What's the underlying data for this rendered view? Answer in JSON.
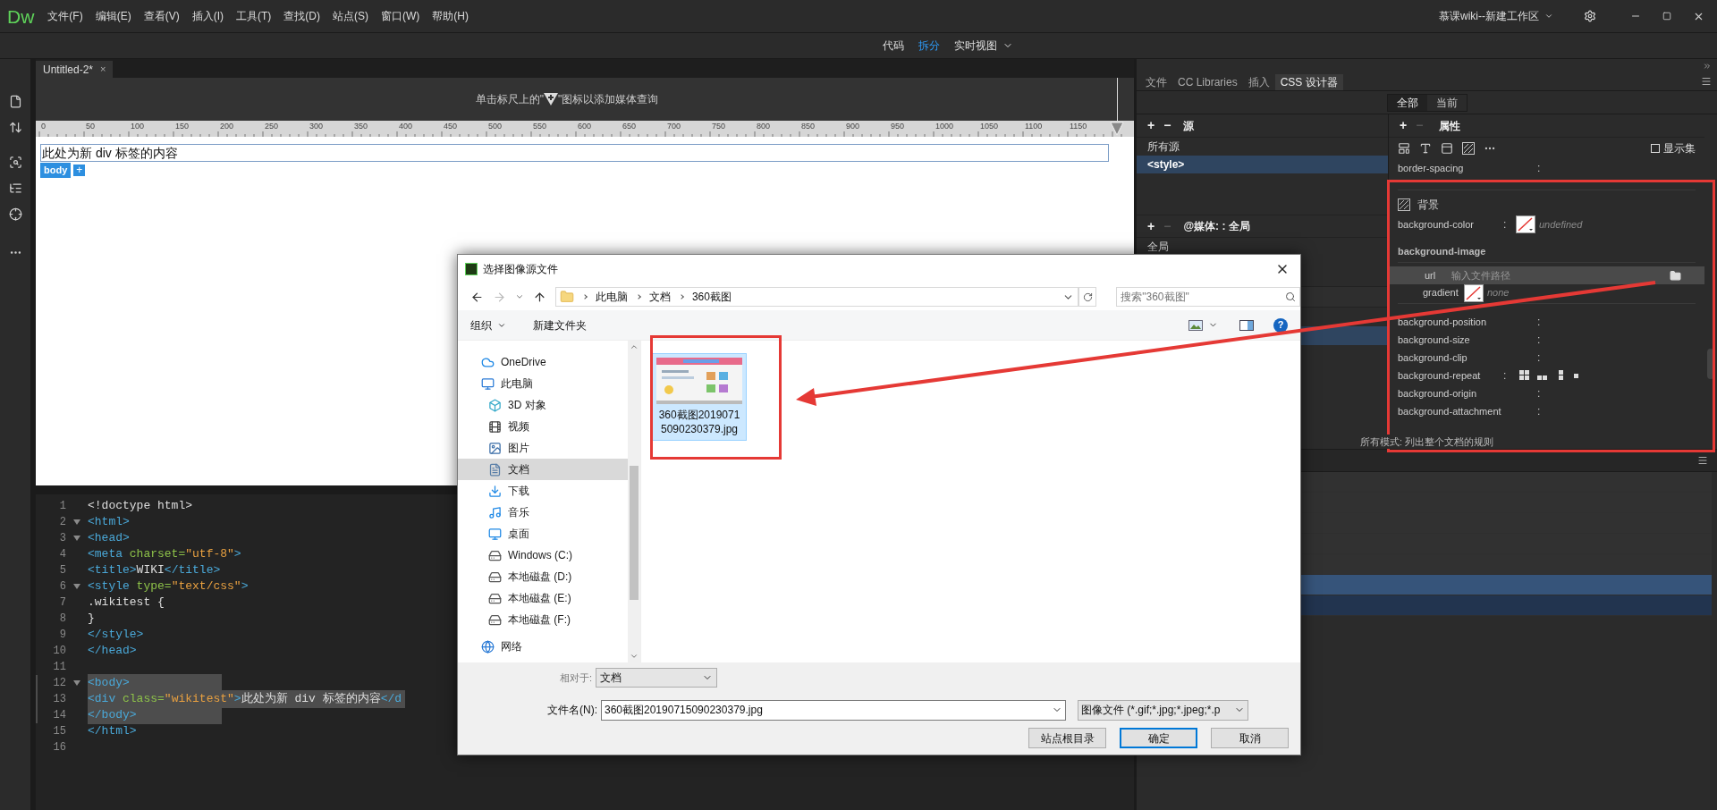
{
  "app": {
    "logo": "Dw",
    "menu": [
      "文件(F)",
      "编辑(E)",
      "查看(V)",
      "插入(I)",
      "工具(T)",
      "查找(D)",
      "站点(S)",
      "窗口(W)",
      "帮助(H)"
    ],
    "workspace": "慕课wiki--新建工作区"
  },
  "view_switch": [
    {
      "label": "代码",
      "selected": false
    },
    {
      "label": "拆分",
      "selected": true
    },
    {
      "label": "实时视图",
      "selected": false
    }
  ],
  "tool_strip": [
    {
      "kind": "file"
    },
    {
      "kind": "transfer"
    },
    {
      "kind": "inspect"
    },
    {
      "kind": "structure"
    },
    {
      "kind": "target"
    },
    {
      "kind": "more"
    }
  ],
  "document_tab": {
    "title": "Untitled-2*",
    "close": "×"
  },
  "design_view": {
    "hint_before": "单击标尺上的\"",
    "hint_after": "\"图标以添加媒体查询",
    "ruler": [
      "0",
      "50",
      "100",
      "150",
      "200",
      "250",
      "300",
      "350",
      "400",
      "450",
      "500",
      "550",
      "600",
      "650",
      "700",
      "750",
      "800",
      "850",
      "900",
      "950",
      "1000",
      "1050",
      "1100",
      "1150"
    ],
    "div_text": "此处为新 div 标签的内容",
    "tag": "body",
    "tag_add": "+"
  },
  "code": {
    "lines": [
      {
        "number": "1",
        "foldable": false,
        "selected": false,
        "tokens": [
          {
            "text": "<!doctype html>",
            "kind": "plain"
          }
        ]
      },
      {
        "number": "2",
        "foldable": true,
        "selected": false,
        "tokens": [
          {
            "text": "<html>",
            "kind": "tag"
          }
        ]
      },
      {
        "number": "3",
        "foldable": true,
        "selected": false,
        "tokens": [
          {
            "text": "<head>",
            "kind": "tag"
          }
        ]
      },
      {
        "number": "4",
        "foldable": false,
        "selected": false,
        "tokens": [
          {
            "text": "<meta ",
            "kind": "tag"
          },
          {
            "text": "charset=",
            "kind": "attr"
          },
          {
            "text": "\"utf-8\"",
            "kind": "string"
          },
          {
            "text": ">",
            "kind": "tag"
          }
        ]
      },
      {
        "number": "5",
        "foldable": false,
        "selected": false,
        "tokens": [
          {
            "text": "<title>",
            "kind": "tag"
          },
          {
            "text": "WIKI",
            "kind": "plain"
          },
          {
            "text": "</title>",
            "kind": "tag"
          }
        ]
      },
      {
        "number": "6",
        "foldable": true,
        "selected": false,
        "tokens": [
          {
            "text": "<style ",
            "kind": "tag"
          },
          {
            "text": "type=",
            "kind": "attr"
          },
          {
            "text": "\"text/css\"",
            "kind": "string"
          },
          {
            "text": ">",
            "kind": "tag"
          }
        ]
      },
      {
        "number": "7",
        "foldable": false,
        "selected": false,
        "tokens": [
          {
            "text": ".wikitest {",
            "kind": "plain"
          }
        ]
      },
      {
        "number": "8",
        "foldable": false,
        "selected": false,
        "tokens": [
          {
            "text": "}",
            "kind": "plain"
          }
        ]
      },
      {
        "number": "9",
        "foldable": false,
        "selected": false,
        "tokens": [
          {
            "text": "</style>",
            "kind": "tag"
          }
        ]
      },
      {
        "number": "10",
        "foldable": false,
        "selected": false,
        "tokens": [
          {
            "text": "</head>",
            "kind": "tag"
          }
        ]
      },
      {
        "number": "11",
        "foldable": false,
        "selected": false
      },
      {
        "number": "12",
        "foldable": true,
        "selected": true,
        "tokens": [
          {
            "text": "<body>",
            "kind": "tag"
          }
        ]
      },
      {
        "number": "13",
        "foldable": false,
        "selected": true,
        "tokens": [
          {
            "text": "<div ",
            "kind": "tag"
          },
          {
            "text": "class=",
            "kind": "attr"
          },
          {
            "text": "\"wikitest\"",
            "kind": "string"
          },
          {
            "text": ">",
            "kind": "tag"
          },
          {
            "text": "此处为新 div 标签的内容",
            "kind": "plain"
          },
          {
            "text": "</d",
            "kind": "tag"
          }
        ]
      },
      {
        "number": "14",
        "foldable": false,
        "selected": true,
        "tokens": [
          {
            "text": "</body>",
            "kind": "tag"
          }
        ]
      },
      {
        "number": "15",
        "foldable": false,
        "selected": false,
        "tokens": [
          {
            "text": "</html>",
            "kind": "tag"
          }
        ]
      },
      {
        "number": "16",
        "foldable": false,
        "selected": false
      }
    ]
  },
  "panel": {
    "tabs": [
      {
        "label": "文件",
        "selected": false
      },
      {
        "label": "CC Libraries",
        "selected": false
      },
      {
        "label": "插入",
        "selected": false
      },
      {
        "label": "CSS 设计器",
        "selected": true
      }
    ],
    "filter": [
      {
        "label": "全部",
        "selected": true
      },
      {
        "label": "当前",
        "selected": false
      }
    ],
    "sources": {
      "add": "+",
      "remove": "−",
      "title": "源",
      "items": [
        {
          "label": "所有源",
          "selected": false
        },
        {
          "label": "<style>",
          "selected": true
        }
      ]
    },
    "media": {
      "add": "+",
      "remove": "−",
      "title": "@媒体: : 全局",
      "items": [
        {
          "label": "全局"
        }
      ]
    },
    "selectors": {
      "rows": [
        {
          "selected": false
        },
        {
          "selected": true
        }
      ]
    },
    "properties": {
      "add": "+",
      "remove": "−",
      "title": "属性",
      "show_set": {
        "label": "显示集",
        "checked": false
      },
      "rows": [
        {
          "kind": "plain",
          "name": "border-spacing",
          "sep": ":"
        },
        {
          "kind": "section",
          "name": "背景"
        },
        {
          "kind": "swatch",
          "name": "background-color",
          "sep": ":",
          "value": "undefined"
        },
        {
          "kind": "heading",
          "name": "background-image"
        },
        {
          "kind": "url",
          "name": "url",
          "placeholder": "输入文件路径"
        },
        {
          "kind": "gradient",
          "name": "gradient",
          "value": "none"
        },
        {
          "kind": "plain",
          "name": "background-position",
          "sep": ":"
        },
        {
          "kind": "plain",
          "name": "background-size",
          "sep": ":"
        },
        {
          "kind": "plain",
          "name": "background-clip",
          "sep": ":"
        },
        {
          "kind": "repeat",
          "name": "background-repeat",
          "sep": ":"
        },
        {
          "kind": "plain",
          "name": "background-origin",
          "sep": ":"
        },
        {
          "kind": "plain",
          "name": "background-attachment",
          "sep": ":"
        }
      ]
    },
    "footer": "所有模式: 列出整个文档的规则",
    "lower_rows": [
      {
        "selected": false,
        "hovered": false
      },
      {
        "selected": false,
        "hovered": false
      },
      {
        "selected": false,
        "hovered": false
      },
      {
        "selected": false,
        "hovered": false
      },
      {
        "selected": false,
        "hovered": false
      },
      {
        "selected": true,
        "hovered": false
      },
      {
        "selected": false,
        "hovered": true
      }
    ]
  },
  "dialog": {
    "title": "选择图像源文件",
    "path": [
      "此电脑",
      "文档",
      "360截图"
    ],
    "search_placeholder": "搜索\"360截图\"",
    "organize": "组织",
    "new_folder": "新建文件夹",
    "help": "?",
    "tree": [
      {
        "label": "OneDrive",
        "kind": "cloud",
        "selected": false
      },
      {
        "label": "此电脑",
        "kind": "pc",
        "selected": false,
        "children": [
          {
            "label": "3D 对象",
            "kind": "cube",
            "selected": false
          },
          {
            "label": "视频",
            "kind": "video",
            "selected": false
          },
          {
            "label": "图片",
            "kind": "pictures",
            "selected": false
          },
          {
            "label": "文档",
            "kind": "documents",
            "selected": true
          },
          {
            "label": "下载",
            "kind": "download",
            "selected": false
          },
          {
            "label": "音乐",
            "kind": "music",
            "selected": false
          },
          {
            "label": "桌面",
            "kind": "desktop",
            "selected": false
          },
          {
            "label": "Windows (C:)",
            "kind": "drive",
            "selected": false
          },
          {
            "label": "本地磁盘 (D:)",
            "kind": "drive",
            "selected": false
          },
          {
            "label": "本地磁盘 (E:)",
            "kind": "drive",
            "selected": false
          },
          {
            "label": "本地磁盘 (F:)",
            "kind": "drive",
            "selected": false
          }
        ]
      },
      {
        "label": "网络",
        "kind": "network",
        "selected": false
      }
    ],
    "files": [
      {
        "name": "360截图20190715090230379.jpg",
        "selected": true
      }
    ],
    "relative_label": "相对于:",
    "relative_value": "文档",
    "filename_label": "文件名(N):",
    "filename_value": "360截图20190715090230379.jpg",
    "filter_value": "图像文件 (*.gif;*.jpg;*.jpeg;*.p",
    "buttons": [
      {
        "label": "站点根目录",
        "kind": "normal"
      },
      {
        "label": "确定",
        "kind": "default"
      },
      {
        "label": "取消",
        "kind": "normal"
      }
    ]
  }
}
